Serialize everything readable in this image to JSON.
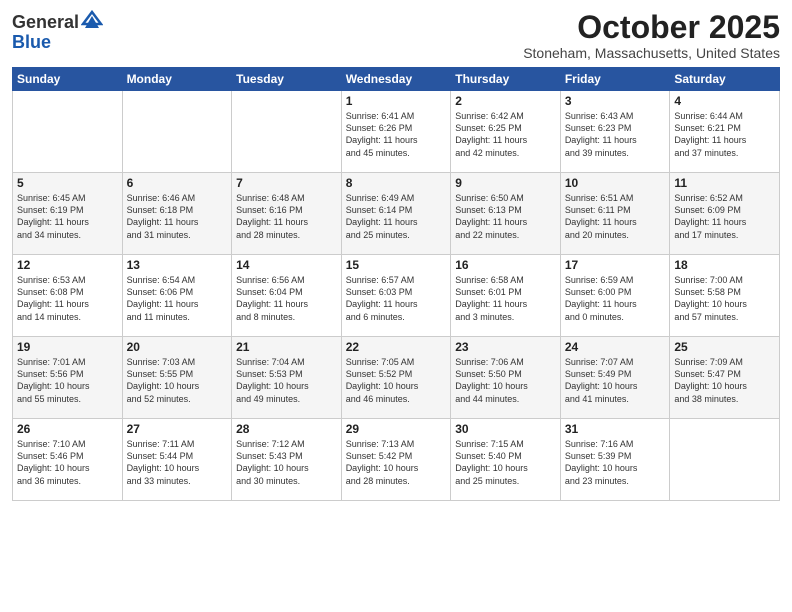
{
  "header": {
    "logo_general": "General",
    "logo_blue": "Blue",
    "month": "October 2025",
    "location": "Stoneham, Massachusetts, United States"
  },
  "weekdays": [
    "Sunday",
    "Monday",
    "Tuesday",
    "Wednesday",
    "Thursday",
    "Friday",
    "Saturday"
  ],
  "weeks": [
    [
      {
        "day": "",
        "info": ""
      },
      {
        "day": "",
        "info": ""
      },
      {
        "day": "",
        "info": ""
      },
      {
        "day": "1",
        "info": "Sunrise: 6:41 AM\nSunset: 6:26 PM\nDaylight: 11 hours\nand 45 minutes."
      },
      {
        "day": "2",
        "info": "Sunrise: 6:42 AM\nSunset: 6:25 PM\nDaylight: 11 hours\nand 42 minutes."
      },
      {
        "day": "3",
        "info": "Sunrise: 6:43 AM\nSunset: 6:23 PM\nDaylight: 11 hours\nand 39 minutes."
      },
      {
        "day": "4",
        "info": "Sunrise: 6:44 AM\nSunset: 6:21 PM\nDaylight: 11 hours\nand 37 minutes."
      }
    ],
    [
      {
        "day": "5",
        "info": "Sunrise: 6:45 AM\nSunset: 6:19 PM\nDaylight: 11 hours\nand 34 minutes."
      },
      {
        "day": "6",
        "info": "Sunrise: 6:46 AM\nSunset: 6:18 PM\nDaylight: 11 hours\nand 31 minutes."
      },
      {
        "day": "7",
        "info": "Sunrise: 6:48 AM\nSunset: 6:16 PM\nDaylight: 11 hours\nand 28 minutes."
      },
      {
        "day": "8",
        "info": "Sunrise: 6:49 AM\nSunset: 6:14 PM\nDaylight: 11 hours\nand 25 minutes."
      },
      {
        "day": "9",
        "info": "Sunrise: 6:50 AM\nSunset: 6:13 PM\nDaylight: 11 hours\nand 22 minutes."
      },
      {
        "day": "10",
        "info": "Sunrise: 6:51 AM\nSunset: 6:11 PM\nDaylight: 11 hours\nand 20 minutes."
      },
      {
        "day": "11",
        "info": "Sunrise: 6:52 AM\nSunset: 6:09 PM\nDaylight: 11 hours\nand 17 minutes."
      }
    ],
    [
      {
        "day": "12",
        "info": "Sunrise: 6:53 AM\nSunset: 6:08 PM\nDaylight: 11 hours\nand 14 minutes."
      },
      {
        "day": "13",
        "info": "Sunrise: 6:54 AM\nSunset: 6:06 PM\nDaylight: 11 hours\nand 11 minutes."
      },
      {
        "day": "14",
        "info": "Sunrise: 6:56 AM\nSunset: 6:04 PM\nDaylight: 11 hours\nand 8 minutes."
      },
      {
        "day": "15",
        "info": "Sunrise: 6:57 AM\nSunset: 6:03 PM\nDaylight: 11 hours\nand 6 minutes."
      },
      {
        "day": "16",
        "info": "Sunrise: 6:58 AM\nSunset: 6:01 PM\nDaylight: 11 hours\nand 3 minutes."
      },
      {
        "day": "17",
        "info": "Sunrise: 6:59 AM\nSunset: 6:00 PM\nDaylight: 11 hours\nand 0 minutes."
      },
      {
        "day": "18",
        "info": "Sunrise: 7:00 AM\nSunset: 5:58 PM\nDaylight: 10 hours\nand 57 minutes."
      }
    ],
    [
      {
        "day": "19",
        "info": "Sunrise: 7:01 AM\nSunset: 5:56 PM\nDaylight: 10 hours\nand 55 minutes."
      },
      {
        "day": "20",
        "info": "Sunrise: 7:03 AM\nSunset: 5:55 PM\nDaylight: 10 hours\nand 52 minutes."
      },
      {
        "day": "21",
        "info": "Sunrise: 7:04 AM\nSunset: 5:53 PM\nDaylight: 10 hours\nand 49 minutes."
      },
      {
        "day": "22",
        "info": "Sunrise: 7:05 AM\nSunset: 5:52 PM\nDaylight: 10 hours\nand 46 minutes."
      },
      {
        "day": "23",
        "info": "Sunrise: 7:06 AM\nSunset: 5:50 PM\nDaylight: 10 hours\nand 44 minutes."
      },
      {
        "day": "24",
        "info": "Sunrise: 7:07 AM\nSunset: 5:49 PM\nDaylight: 10 hours\nand 41 minutes."
      },
      {
        "day": "25",
        "info": "Sunrise: 7:09 AM\nSunset: 5:47 PM\nDaylight: 10 hours\nand 38 minutes."
      }
    ],
    [
      {
        "day": "26",
        "info": "Sunrise: 7:10 AM\nSunset: 5:46 PM\nDaylight: 10 hours\nand 36 minutes."
      },
      {
        "day": "27",
        "info": "Sunrise: 7:11 AM\nSunset: 5:44 PM\nDaylight: 10 hours\nand 33 minutes."
      },
      {
        "day": "28",
        "info": "Sunrise: 7:12 AM\nSunset: 5:43 PM\nDaylight: 10 hours\nand 30 minutes."
      },
      {
        "day": "29",
        "info": "Sunrise: 7:13 AM\nSunset: 5:42 PM\nDaylight: 10 hours\nand 28 minutes."
      },
      {
        "day": "30",
        "info": "Sunrise: 7:15 AM\nSunset: 5:40 PM\nDaylight: 10 hours\nand 25 minutes."
      },
      {
        "day": "31",
        "info": "Sunrise: 7:16 AM\nSunset: 5:39 PM\nDaylight: 10 hours\nand 23 minutes."
      },
      {
        "day": "",
        "info": ""
      }
    ]
  ]
}
